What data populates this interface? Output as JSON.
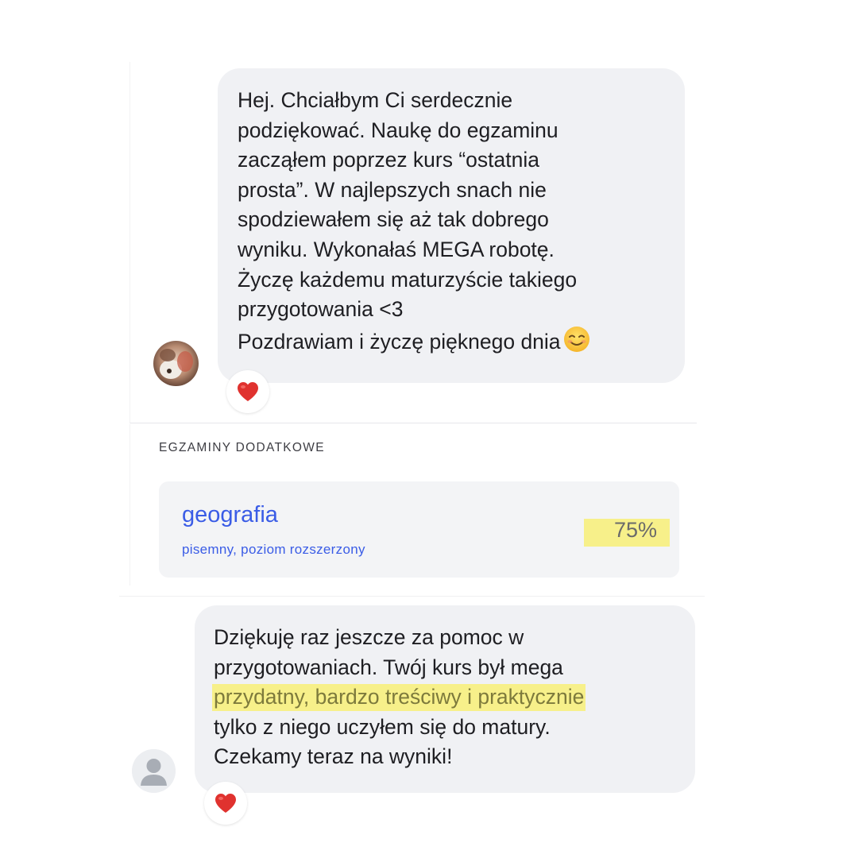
{
  "messages": [
    {
      "lines": [
        "Hej. Chciałbym Ci serdecznie",
        "podziękować. Naukę do egzaminu",
        "zacząłem poprzez kurs “ostatnia",
        "prosta”. W najlepszych snach nie",
        "spodziewałem się aż tak dobrego",
        "wyniku. Wykonałaś MEGA robotę.",
        "Życzę każdemu maturzyście takiego",
        "przygotowania <3",
        "Pozdrawiam i życzę pięknego dnia"
      ],
      "trailing_emoji": "smiling-face-icon",
      "reaction": "heart-icon"
    },
    {
      "lines": [
        "Dziękuję raz jeszcze za pomoc w",
        "przygotowaniach. Twój kurs był mega"
      ],
      "highlighted_line": "przydatny, bardzo treściwy i praktycznie",
      "lines_after": [
        "tylko z niego uczyłem się do matury.",
        "Czekamy teraz na wyniki!"
      ],
      "reaction": "heart-icon"
    }
  ],
  "exams": {
    "heading": "EGZAMINY DODATKOWE",
    "items": [
      {
        "subject": "geografia",
        "type": "pisemny, poziom rozszerzony",
        "score": "75%"
      }
    ]
  },
  "colors": {
    "bubble": "#f0f1f4",
    "highlight": "#f7f08a",
    "accent_blue": "#3a5ce6",
    "heart": "#e0322f"
  }
}
